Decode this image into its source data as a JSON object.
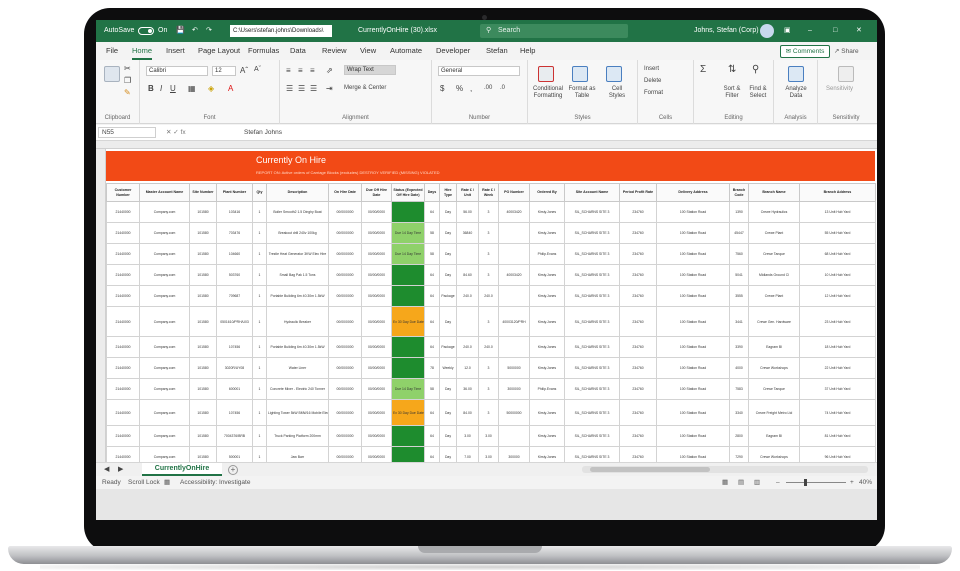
{
  "titlebar": {
    "autosave_label": "AutoSave",
    "toggle_state": "On",
    "path": "C:\\Users\\stefan.johns\\Downloads\\",
    "filename": "CurrentlyOnHire (30).xlsx",
    "search_placeholder": "Search",
    "user_name": "Johns, Stefan (Corp)"
  },
  "menu": {
    "tabs": [
      "File",
      "Home",
      "Insert",
      "Page Layout",
      "Formulas",
      "Data",
      "Review",
      "View",
      "Automate",
      "Developer",
      "Stefan",
      "Help"
    ],
    "active": "Home",
    "comments_label": "Comments",
    "share_label": "Share"
  },
  "ribbon": {
    "clipboard": "Clipboard",
    "font_name": "Calibri",
    "font_size": "12",
    "font": "Font",
    "wrap_text": "Wrap Text",
    "merge_center": "Merge & Center",
    "alignment": "Alignment",
    "number_format": "General",
    "number": "Number",
    "conditional_formatting": "Conditional Formatting",
    "format_as_table": "Format as Table",
    "cell_styles": "Cell Styles",
    "styles": "Styles",
    "insert": "Insert",
    "delete": "Delete",
    "format": "Format",
    "cells": "Cells",
    "sort_filter": "Sort & Filter",
    "find_select": "Find & Select",
    "editing": "Editing",
    "analyze_data": "Analyze Data",
    "analysis": "Analysis",
    "sensitivity": "Sensitivity"
  },
  "formula": {
    "cell_ref": "N55",
    "fx": "fx",
    "content": "Stefan Johns"
  },
  "report": {
    "title": "Currently On Hire",
    "subtitle": "REPORT ON: Active orders of Carriage Blocks (excludes) DESTROY VERIFIED (MISSING) VIOLATED"
  },
  "table": {
    "headers": [
      "Customer Number",
      "Master Account Name",
      "Site Number",
      "Plant Number",
      "Qty",
      "Description",
      "On Hire Date",
      "Due Off Hire Date",
      "Status (Expected Off Hire Date)",
      "Days",
      "Hire Type",
      "Rate £ / Unit",
      "Rate £ / Week",
      "PO Number",
      "Ordered By",
      "Site Account Name",
      "Period Profit Rate",
      "Delivery Address",
      "Branch Code",
      "Branch Name",
      "Branch Address"
    ],
    "rows": [
      {
        "cells": [
          "21440000",
          "Company.com",
          "101580",
          "103416",
          "1",
          "Boiler Smooth2 1.5 Dinghy Boat",
          "00/00/0000",
          "00/00/0000",
          "",
          "64",
          "Day",
          "56.00",
          "3",
          "40003420",
          "Kirsty.Jones",
          "SIL_SCHARNS SITE 3",
          "234760",
          "100 Station Road",
          "1390",
          "Crewe Hydraulics",
          "13 Unit Hub Yard"
        ],
        "status": "st-green"
      },
      {
        "cells": [
          "21440000",
          "Company.com",
          "101580",
          "703476",
          "1",
          "Breakout drill 240v 100kg",
          "00/00/0000",
          "00/00/0000",
          "Due 14 Day Time",
          "58",
          "Day",
          "36840",
          "3",
          "",
          "Kirsty.Jones",
          "SIL_SCHARNS SITE 3",
          "234760",
          "100 Station Road",
          "45447",
          "Crewe Plant",
          "55 Unit Hub Yard"
        ],
        "status": "st-light"
      },
      {
        "cells": [
          "21440000",
          "Company.com",
          "101580",
          "104660",
          "1",
          "Trestle Heat Generator 3KW Elec Hire",
          "00/00/0000",
          "00/00/0000",
          "Due 14 Day Time",
          "58",
          "Day",
          "",
          "3",
          "",
          "Philip.Evans",
          "SIL_SCHARNS SITE 3",
          "234760",
          "100 Station Road",
          "7560",
          "Crewe Tanque",
          "68 Unit Hub Yard"
        ],
        "status": "st-light"
      },
      {
        "cells": [
          "21440000",
          "Company.com",
          "101580",
          "503760",
          "1",
          "Small Bag Pak 1.5 Tons",
          "00/00/0000",
          "00/00/0000",
          "",
          "64",
          "Day",
          "84.60",
          "3",
          "40003420",
          "Kirsty.Jones",
          "SIL_SCHARNS SITE 3",
          "234760",
          "100 Station Road",
          "5041",
          "Midlands Ground Cl",
          "10 Unit Hub Yard"
        ],
        "status": "st-green"
      },
      {
        "cells": [
          "21440000",
          "Company.com",
          "101580",
          "709687",
          "1",
          "Portable Building 6m 40.30m 1.5kW",
          "00/00/0000",
          "00/00/0000",
          "",
          "64",
          "Package",
          "240.0",
          "240.0",
          "",
          "Kirsty.Jones",
          "SIL_SCHARNS SITE 3",
          "234760",
          "100 Station Road",
          "3555",
          "Crewe Plant",
          "12 Unit Hub Yard"
        ],
        "status": "st-green"
      },
      {
        "cells": [
          "21440000",
          "Company.com",
          "101580",
          "0501610/PRH/U03",
          "1",
          "Hydraulic Breaker",
          "00/00/0000",
          "00/00/0000",
          "Ex 30 Day Due Date",
          "64",
          "Day",
          "",
          "3",
          "40003120/PRH",
          "Kirsty.Jones",
          "SIL_SCHARNS SITE 3",
          "234760",
          "100 Station Road",
          "3441",
          "Crewe Gen. Hardware",
          "23 Unit Hub Yard"
        ],
        "status": "st-amber"
      },
      {
        "cells": [
          "21440000",
          "Company.com",
          "101580",
          "107456",
          "1",
          "Portable Building 6m 40.30m 1.5kW",
          "00/00/0000",
          "00/00/0000",
          "",
          "64",
          "Package",
          "240.0",
          "240.0",
          "",
          "Kirsty.Jones",
          "SIL_SCHARNS SITE 3",
          "234760",
          "100 Station Road",
          "3390",
          "Eagram Bl",
          "18 Unit Hub Yard"
        ],
        "status": "st-green"
      },
      {
        "cells": [
          "21440000",
          "Company.com",
          "101580",
          "3020R/UY08",
          "1",
          "Water Liner",
          "00/00/0000",
          "00/00/0000",
          "",
          "78",
          "Weekly",
          "12.0",
          "3",
          "5000000",
          "Kirsty.Jones",
          "SIL_SCHARNS SITE 3",
          "234760",
          "100 Station Road",
          "4000",
          "Crewe Workshops",
          "22 Unit Hub Yard"
        ],
        "status": "st-green"
      },
      {
        "cells": [
          "21440000",
          "Company.com",
          "101580",
          "600001",
          "1",
          "Concrete Mixer - Electric 240 Tonner",
          "00/00/0000",
          "00/00/0000",
          "Due 14 Day Time",
          "58",
          "Day",
          "36.00",
          "3",
          "3000000",
          "Philip.Evans",
          "SIL_SCHARNS SITE 3",
          "234760",
          "100 Station Road",
          "7583",
          "Crewe Tanque",
          "37 Unit Hub Yard"
        ],
        "status": "st-light"
      },
      {
        "cells": [
          "21440000",
          "Company.com",
          "101580",
          "107456",
          "1",
          "Lighting Tower 5kW BMW16 Mobile Electric Tower",
          "00/00/0000",
          "00/00/0000",
          "Ex 30 Day Due Date",
          "64",
          "Day",
          "84.00",
          "3",
          "50000000",
          "Kirsty.Jones",
          "SIL_SCHARNS SITE 3",
          "234760",
          "100 Station Road",
          "3340",
          "Crewe Freight Metro Ltd",
          "74 Unit Hub Yard"
        ],
        "status": "st-amber"
      },
      {
        "cells": [
          "21440000",
          "Company.com",
          "101580",
          "7004376/BRB",
          "1",
          "Truck Parking Platform 200mm",
          "00/00/0000",
          "00/00/0000",
          "",
          "64",
          "Day",
          "3.00",
          "3.00",
          "",
          "Kirsty.Jones",
          "SIL_SCHARNS SITE 3",
          "234760",
          "100 Station Road",
          "2800",
          "Eagram Bl",
          "81 Unit Hub Yard"
        ],
        "status": "st-green"
      },
      {
        "cells": [
          "21440000",
          "Company.com",
          "101580",
          "500001",
          "1",
          "Jaw Barr",
          "00/00/0000",
          "00/00/0000",
          "",
          "64",
          "Day",
          "7.00",
          "3.00",
          "300000",
          "Kirsty.Jones",
          "SIL_SCHARNS SITE 3",
          "234760",
          "100 Station Road",
          "7290",
          "Crewe Workshops",
          "96 Unit Hub Yard"
        ],
        "status": "st-green"
      }
    ]
  },
  "sheets": {
    "active_sheet": "CurrentlyOnHire",
    "add_sheet": "+"
  },
  "status": {
    "ready": "Ready",
    "scroll_lock": "Scroll Lock",
    "accessibility": "Accessibility: Investigate",
    "zoom": "40%"
  }
}
